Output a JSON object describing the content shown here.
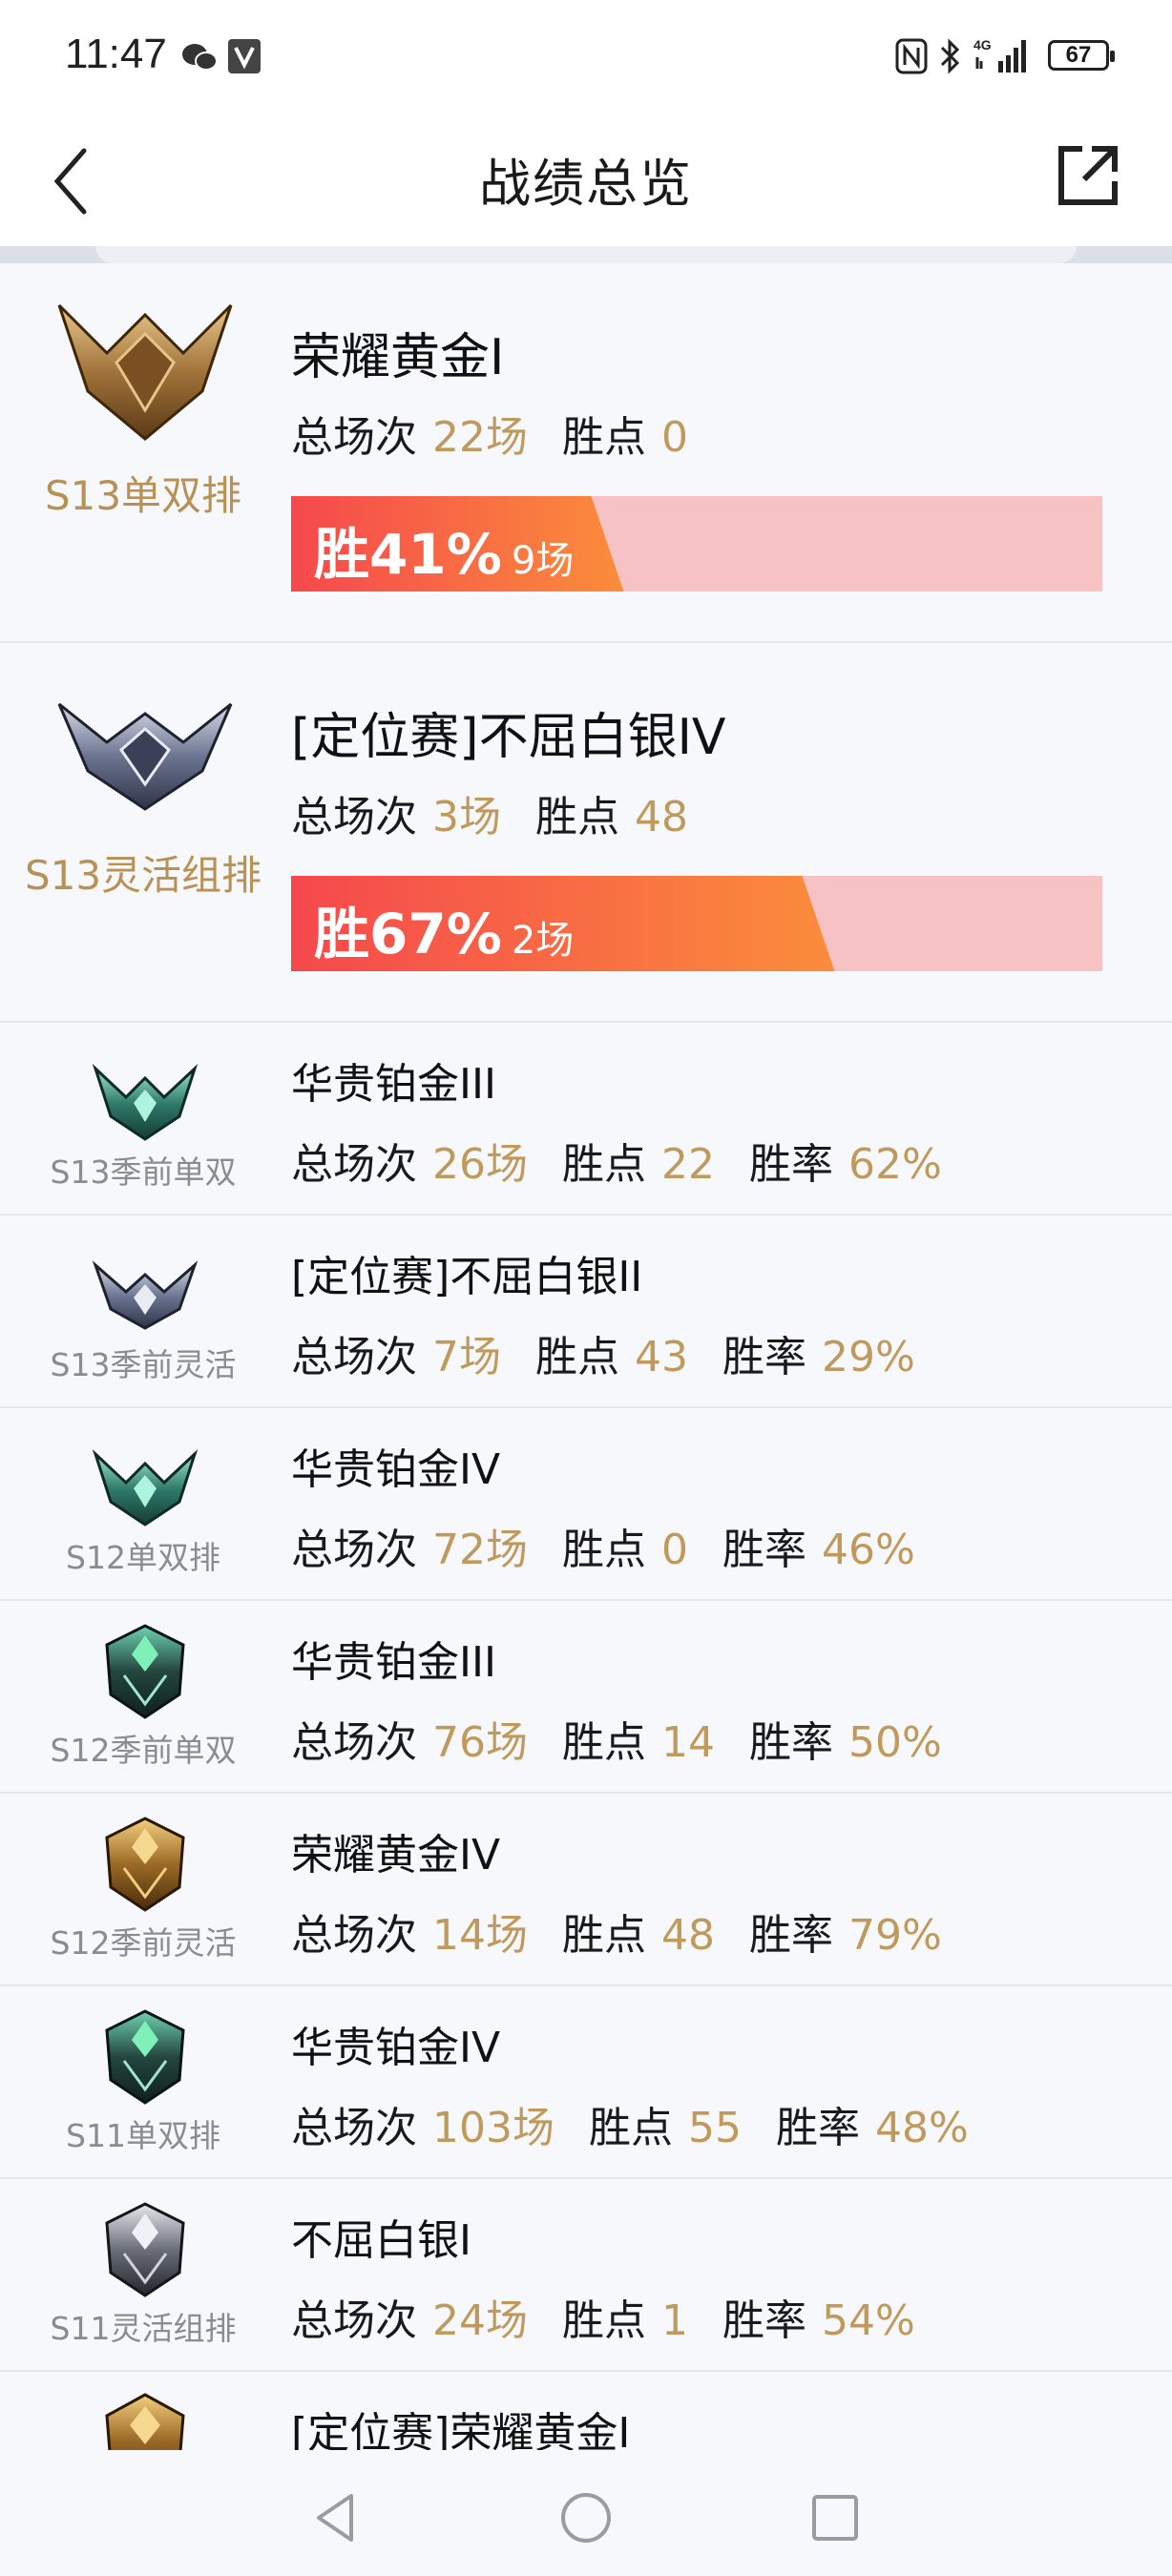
{
  "status_bar": {
    "time": "11:47",
    "battery": "67",
    "network": "4G",
    "icons": [
      "wechat-icon",
      "app-notification-icon",
      "nfc-icon",
      "bluetooth-icon",
      "signal-icon",
      "battery-icon"
    ]
  },
  "header": {
    "title": "战绩总览",
    "back_icon": "chevron-left-icon",
    "share_icon": "external-link-icon"
  },
  "labels": {
    "total_games": "总场次",
    "lp": "胜点",
    "win_rate": "胜率"
  },
  "featured": [
    {
      "season": "S13单双排",
      "rank": "荣耀黄金I",
      "games": "22场",
      "lp": "0",
      "win_pct": "胜41%",
      "win_games": "9场",
      "win_fraction": 0.41,
      "emblem": "gold"
    },
    {
      "season": "S13灵活组排",
      "rank": "[定位赛]不屈白银IV",
      "games": "3场",
      "lp": "48",
      "win_pct": "胜67%",
      "win_games": "2场",
      "win_fraction": 0.67,
      "emblem": "silver"
    }
  ],
  "history": [
    {
      "season": "S13季前单双",
      "rank": "华贵铂金III",
      "games": "26场",
      "lp": "22",
      "win_rate": "62%",
      "emblem": "platinum-wing"
    },
    {
      "season": "S13季前灵活",
      "rank": "[定位赛]不屈白银II",
      "games": "7场",
      "lp": "43",
      "win_rate": "29%",
      "emblem": "silver-wing"
    },
    {
      "season": "S12单双排",
      "rank": "华贵铂金IV",
      "games": "72场",
      "lp": "0",
      "win_rate": "46%",
      "emblem": "platinum-wing"
    },
    {
      "season": "S12季前单双",
      "rank": "华贵铂金III",
      "games": "76场",
      "lp": "14",
      "win_rate": "50%",
      "emblem": "platinum-helm"
    },
    {
      "season": "S12季前灵活",
      "rank": "荣耀黄金IV",
      "games": "14场",
      "lp": "48",
      "win_rate": "79%",
      "emblem": "gold-helm"
    },
    {
      "season": "S11单双排",
      "rank": "华贵铂金IV",
      "games": "103场",
      "lp": "55",
      "win_rate": "48%",
      "emblem": "platinum-helm"
    },
    {
      "season": "S11灵活组排",
      "rank": "不屈白银I",
      "games": "24场",
      "lp": "1",
      "win_rate": "54%",
      "emblem": "silver-helm"
    }
  ],
  "partial": {
    "rank": "[定位赛]荣耀黄金I",
    "emblem": "gold-helm"
  },
  "nav": {
    "icons": [
      "back-triangle-icon",
      "home-circle-icon",
      "recents-square-icon"
    ]
  },
  "colors": {
    "accent_gold": "#c09a5c",
    "season_gold": "#b89155",
    "win_gradient_start": "#f5484d",
    "win_gradient_end": "#fb8d3b",
    "bar_background": "#f7c2c4"
  }
}
